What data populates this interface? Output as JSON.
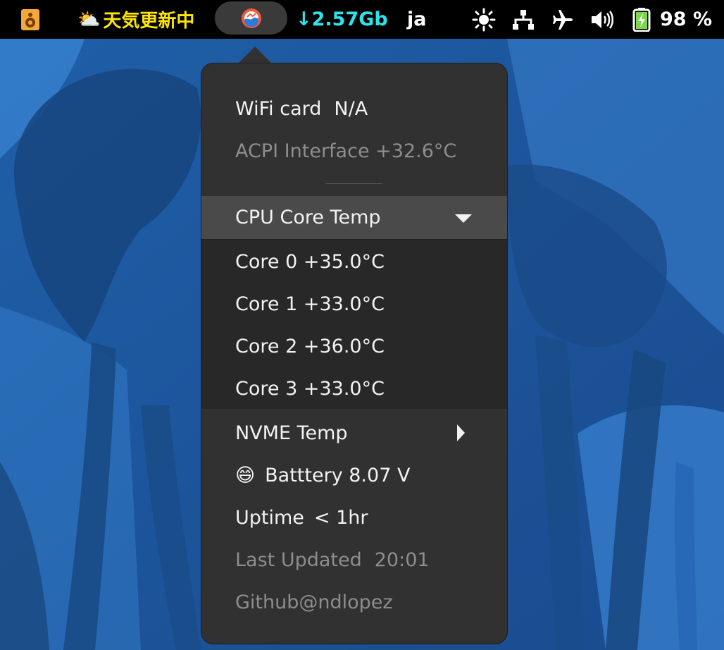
{
  "topbar": {
    "weather_icon": "sun-behind-cloud-icon",
    "weather_text": "天気更新中",
    "netspeed": "↓2.57Gb",
    "language": "ja",
    "battery_percent": "98 %"
  },
  "menu": {
    "wifi_label": "WiFi card",
    "wifi_value": "N/A",
    "acpi": "ACPI Interface +32.6°C",
    "cpu_header": "CPU Core Temp",
    "cores": [
      "Core 0 +35.0°C",
      "Core 1 +33.0°C",
      "Core 2 +36.0°C",
      "Core 3 +33.0°C"
    ],
    "nvme": "NVME Temp",
    "battery_emoji": "😄",
    "battery": "Batttery 8.07 V",
    "uptime_label": "Uptime",
    "uptime_value": "< 1hr",
    "last_updated_label": "Last Updated",
    "last_updated_value": "20:01",
    "github": "Github@ndlopez"
  },
  "colors": {
    "topbar_bg": "#000000",
    "weather_text": "#ffe600",
    "netspeed_text": "#2ee3ea",
    "menu_bg": "#313131",
    "submenu_header_bg": "#4a4a4a",
    "submenu_bg": "#282828"
  }
}
